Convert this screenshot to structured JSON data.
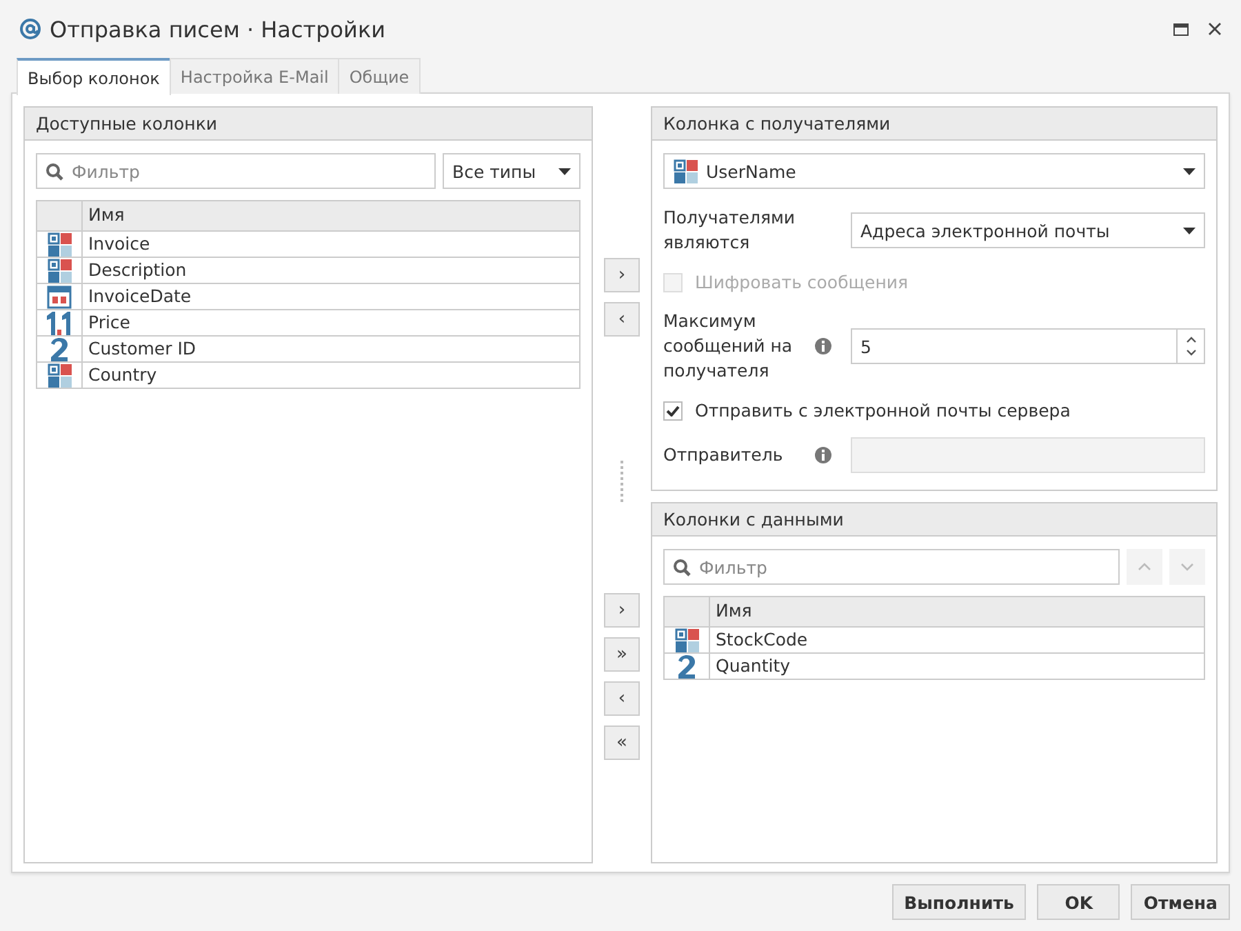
{
  "window": {
    "title": "Отправка писем · Настройки"
  },
  "tabs": [
    {
      "label": "Выбор колонок",
      "selected": true
    },
    {
      "label": "Настройка E-Mail",
      "selected": false
    },
    {
      "label": "Общие",
      "selected": false
    }
  ],
  "available": {
    "title": "Доступные колонки",
    "filter": {
      "placeholder": "Фильтр"
    },
    "type_select": {
      "value": "Все типы"
    },
    "table": {
      "columns": [
        "Имя"
      ],
      "rows": [
        {
          "kind": "text",
          "name": "Invoice"
        },
        {
          "kind": "text",
          "name": "Description"
        },
        {
          "kind": "date",
          "name": "InvoiceDate"
        },
        {
          "kind": "decimal",
          "name": "Price"
        },
        {
          "kind": "integer",
          "name": "Customer ID"
        },
        {
          "kind": "text",
          "name": "Country"
        }
      ]
    }
  },
  "transfer_top": [
    "›",
    "‹"
  ],
  "recipients": {
    "title": "Колонка с получателями",
    "column_select": {
      "kind": "text",
      "value": "UserName"
    },
    "recipients_are": {
      "label": "Получателями являются",
      "value": "Адреса электронной почты"
    },
    "encrypt": {
      "label": "Шифровать сообщения",
      "checked": false,
      "disabled": true
    },
    "max_messages": {
      "label": "Максимум сообщений на получателя",
      "value": "5"
    },
    "send_from_server": {
      "label": "Отправить с электронной почты сервера",
      "checked": true,
      "disabled": false
    },
    "sender": {
      "label": "Отправитель",
      "disabled": true
    }
  },
  "transfer_bottom": [
    "›",
    "»",
    "‹",
    "«"
  ],
  "data_columns": {
    "title": "Колонки с данными",
    "filter": {
      "placeholder": "Фильтр"
    },
    "move_up_disabled": true,
    "move_down_disabled": true,
    "table": {
      "columns": [
        "Имя"
      ],
      "rows": [
        {
          "kind": "text",
          "name": "StockCode"
        },
        {
          "kind": "integer",
          "name": "Quantity"
        }
      ]
    }
  },
  "buttons": [
    "Выполнить",
    "OK",
    "Отмена"
  ]
}
